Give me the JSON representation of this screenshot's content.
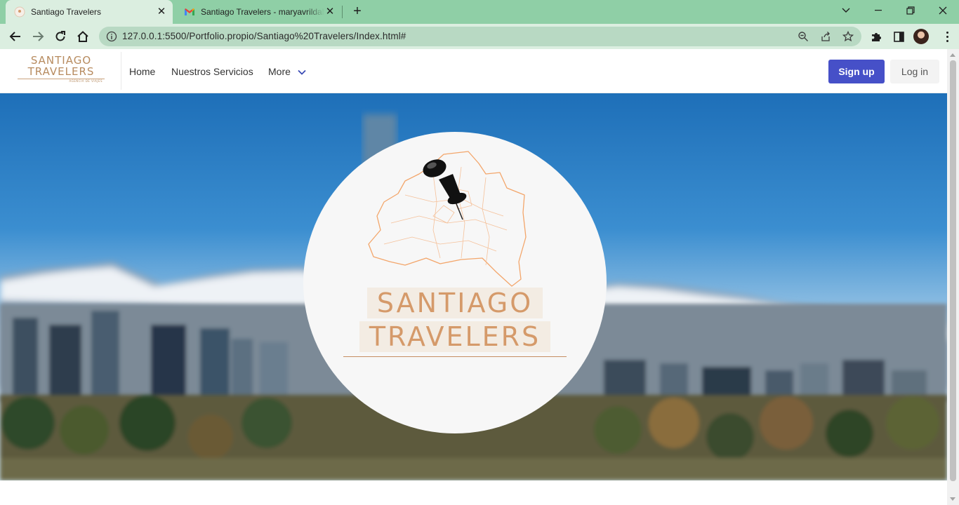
{
  "browser": {
    "tabs": [
      {
        "title": "Santiago Travelers",
        "active": true,
        "favicon": "site-favicon"
      },
      {
        "title": "Santiago Travelers - maryavrildab",
        "active": false,
        "favicon": "gmail-favicon"
      }
    ],
    "url": "127.0.0.1:5500/Portfolio.propio/Santiago%20Travelers/Index.html#",
    "colors": {
      "frame": "#8fcfa6",
      "toolbar": "#dbeee0",
      "omnibox": "#b8d9c3"
    }
  },
  "site": {
    "logo": {
      "line1": "SANTIAGO",
      "line2": "TRAVELERS",
      "tagline": "AGENCIA DE VIAJES"
    },
    "nav": {
      "home": "Home",
      "services": "Nuestros Servicios",
      "more": "More"
    },
    "auth": {
      "signup": "Sign up",
      "login": "Log in"
    },
    "colors": {
      "brand": "#4650c8",
      "logo": "#b78b5f",
      "emblem_text": "#d59a6a"
    }
  },
  "hero": {
    "emblem_line1": "SANTIAGO",
    "emblem_line2": "TRAVELERS",
    "background": "blurred Santiago skyline with snowy Andes mountains",
    "emblem_icon": "pushpin-map-icon"
  }
}
